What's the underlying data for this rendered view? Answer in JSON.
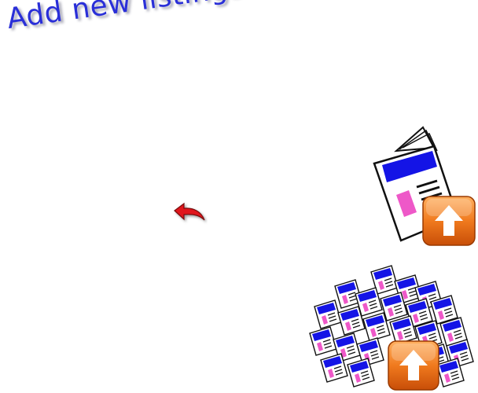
{
  "page": {
    "title": "Add new listings"
  },
  "icons": {
    "back": "back-arrow-icon",
    "single": "single-listing-upload-icon",
    "bulk": "bulk-listings-upload-icon",
    "upload": "upload-arrow-icon"
  },
  "colors": {
    "title": "#2a2fd8",
    "accent_orange": "#f07a1e",
    "arrow_red": "#e0141e",
    "paper_blue": "#1414e6",
    "paper_pink": "#ee58c8"
  }
}
